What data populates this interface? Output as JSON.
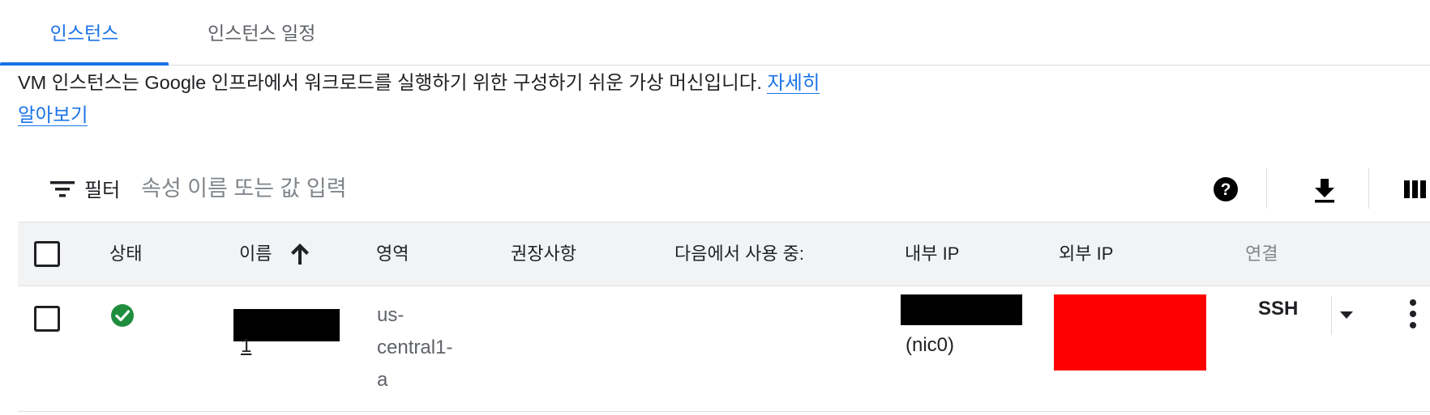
{
  "tabs": [
    {
      "label": "인스턴스",
      "active": true
    },
    {
      "label": "인스턴스 일정",
      "active": false
    }
  ],
  "description": {
    "text": "VM 인스턴스는 Google 인프라에서 워크로드를 실행하기 위한 구성하기 쉬운 가상 머신입니다. ",
    "link": "자세히 알아보기"
  },
  "filter": {
    "icon": "filter-icon",
    "label": "필터",
    "placeholder": "속성 이름 또는 값 입력"
  },
  "toolbar": {
    "icons": [
      "help-icon",
      "download-icon",
      "columns-icon"
    ]
  },
  "table": {
    "headers": {
      "status": "상태",
      "name": "이름",
      "zone": "영역",
      "recommendation": "권장사항",
      "in_use_by": "다음에서 사용 중:",
      "internal_ip": "내부 IP",
      "external_ip": "외부 IP",
      "connect": "연결"
    },
    "sort": {
      "column": "name",
      "direction": "ascending",
      "icon": "arrow-up-icon"
    },
    "rows": [
      {
        "status_icon": "check-circle-icon",
        "name_suffix": "1",
        "zone": [
          "us-",
          "central1-",
          "a"
        ],
        "internal_ip_nic": "(nic0)",
        "connect": "SSH",
        "menu_icon": "more-vert-icon"
      }
    ]
  },
  "colors": {
    "accent": "#1a73e8",
    "status_ok": "#1e8e3e",
    "header_bg": "#f1f3f4",
    "redaction_black": "#000000",
    "redaction_red": "#ff0000"
  }
}
